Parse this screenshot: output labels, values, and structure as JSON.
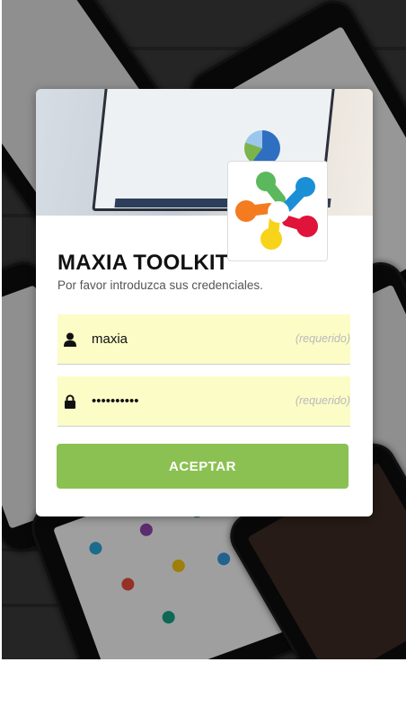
{
  "app": {
    "title": "MAXIA TOOLKIT",
    "subtitle": "Por favor introduzca sus credenciales."
  },
  "form": {
    "username": {
      "value": "maxia",
      "hint": "(requerido)",
      "icon": "user-icon"
    },
    "password": {
      "value": "••••••••••",
      "hint": "(requerido)",
      "icon": "lock-icon"
    },
    "submit_label": "ACEPTAR"
  },
  "colors": {
    "button": "#8bc152",
    "field_bg": "#fcfcc7",
    "logo_green": "#5cb85c",
    "logo_blue": "#1a8fd6",
    "logo_orange": "#f47b20",
    "logo_yellow": "#f7d31a",
    "logo_red": "#e0133a"
  }
}
